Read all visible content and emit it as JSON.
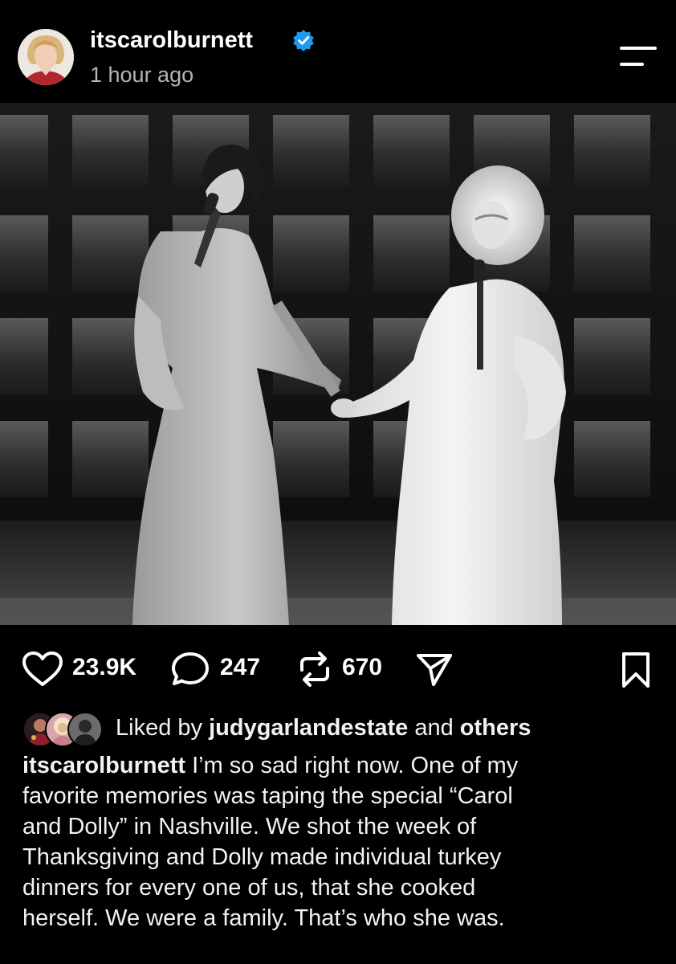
{
  "post": {
    "username": "itscarolburnett",
    "timestamp": "1 hour ago",
    "verified": true
  },
  "actions": {
    "likes": "23.9K",
    "comments": "247",
    "reposts": "670"
  },
  "liked_by": {
    "prefix": "Liked by",
    "user": "judygarlandestate",
    "connector": "and",
    "others": "others"
  },
  "caption": {
    "user": "itscarolburnett",
    "lines": [
      " I’m so sad right now. One of my",
      "favorite memories was taping the special “Carol",
      "and Dolly” in Nashville. We shot the week of",
      "Thanksgiving and Dolly made individual turkey",
      "dinners for every one of us, that she cooked",
      "herself. We were a family. That’s who she was."
    ]
  },
  "icons": {
    "verified": "verified-badge-icon",
    "menu": "menu-icon",
    "like": "heart-icon",
    "comment": "comment-icon",
    "repost": "repost-icon",
    "share": "send-icon",
    "save": "bookmark-icon"
  },
  "colors": {
    "background": "#000000",
    "verified_blue": "#1d9bf0",
    "text": "#f5f5f5",
    "secondary_text": "#b5b5b5"
  }
}
